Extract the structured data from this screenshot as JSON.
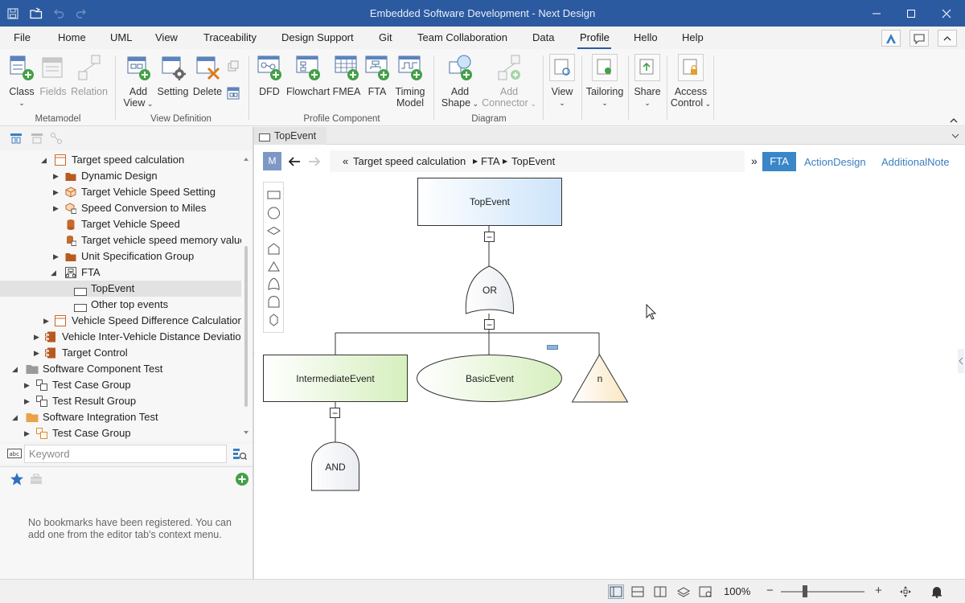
{
  "app": {
    "title": "Embedded Software Development - Next Design"
  },
  "menu": {
    "items": [
      "File",
      "Home",
      "UML",
      "View",
      "Traceability",
      "Design Support",
      "Git",
      "Team Collaboration",
      "Data",
      "Profile",
      "Hello",
      "Help"
    ],
    "active": "Profile"
  },
  "ribbon": {
    "metamodel": {
      "label": "Metamodel",
      "class": "Class",
      "fields": "Fields",
      "relation": "Relation"
    },
    "view_definition": {
      "label": "View Definition",
      "add_view_1": "Add",
      "add_view_2": "View",
      "setting": "Setting",
      "delete": "Delete"
    },
    "profile_component": {
      "label": "Profile Component",
      "dfd": "DFD",
      "flowchart": "Flowchart",
      "fmea": "FMEA",
      "fta": "FTA",
      "timing_1": "Timing",
      "timing_2": "Model"
    },
    "diagram": {
      "label": "Diagram",
      "add_shape_1": "Add",
      "add_shape_2": "Shape",
      "add_connector_1": "Add",
      "add_connector_2": "Connector"
    },
    "view": "View",
    "tailoring": "Tailoring",
    "share": "Share",
    "access_1": "Access",
    "access_2": "Control"
  },
  "tree": {
    "items": [
      {
        "label": "Target speed calculation",
        "selected": false
      },
      {
        "label": "Dynamic Design",
        "selected": false
      },
      {
        "label": "Target Vehicle Speed Setting",
        "selected": false
      },
      {
        "label": "Speed Conversion to Miles",
        "selected": false
      },
      {
        "label": "Target Vehicle Speed",
        "selected": false
      },
      {
        "label": "Target vehicle speed memory value",
        "selected": false
      },
      {
        "label": "Unit Specification Group",
        "selected": false
      },
      {
        "label": "FTA",
        "selected": false
      },
      {
        "label": "TopEvent",
        "selected": true
      },
      {
        "label": "Other top events",
        "selected": false
      },
      {
        "label": "Vehicle Speed Difference Calculation",
        "selected": false
      },
      {
        "label": "Vehicle Inter-Vehicle Distance Deviation",
        "selected": false
      },
      {
        "label": "Target Control",
        "selected": false
      },
      {
        "label": "Software Component Test",
        "selected": false
      },
      {
        "label": "Test Case Group",
        "selected": false
      },
      {
        "label": "Test Result Group",
        "selected": false
      },
      {
        "label": "Software Integration Test",
        "selected": false
      },
      {
        "label": "Test Case Group",
        "selected": false
      }
    ]
  },
  "search": {
    "placeholder": "Keyword"
  },
  "bookmarks": {
    "empty_message": "No bookmarks have been registered. You can add one from the editor tab's context menu."
  },
  "editor": {
    "tab_label": "TopEvent",
    "mode_badge": "M",
    "breadcrumb": [
      "Target speed calculation",
      "FTA",
      "TopEvent"
    ],
    "breadcrumb_prefix": "«",
    "overflow": "»",
    "views": [
      {
        "label": "FTA",
        "active": true
      },
      {
        "label": "ActionDesign",
        "active": false
      },
      {
        "label": "AdditionalNote",
        "active": false
      }
    ],
    "collapse_glyph": "−",
    "nodes": {
      "top_event": "TopEvent",
      "or_gate": "OR",
      "intermediate_event": "IntermediateEvent",
      "basic_event": "BasicEvent",
      "transfer": "n",
      "and_gate": "AND"
    }
  },
  "status": {
    "zoom": "100%",
    "minus": "−",
    "plus": "+"
  },
  "colors": {
    "titlebar": "#2c5aa0",
    "accent": "#3a7fc1",
    "tab_active": "#3a86c8"
  }
}
